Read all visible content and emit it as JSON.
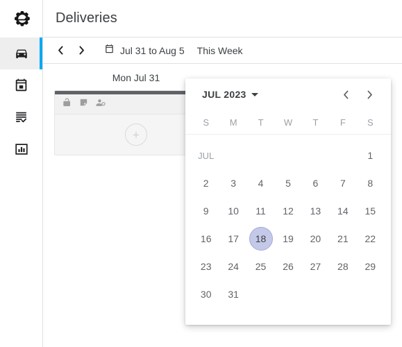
{
  "sidebar": {
    "logo_name": "gear-logo",
    "items": [
      {
        "name": "deliveries",
        "icon": "car-icon",
        "active": true
      },
      {
        "name": "calendar",
        "icon": "calendar-icon",
        "active": false
      },
      {
        "name": "tasks",
        "icon": "list-check-icon",
        "active": false
      },
      {
        "name": "reports",
        "icon": "bar-chart-icon",
        "active": false
      }
    ],
    "accent_color": "#03a9f4",
    "active_bg": "#eeeeee"
  },
  "header": {
    "title": "Deliveries"
  },
  "toolbar": {
    "prev_label": "‹",
    "next_label": "›",
    "calendar_icon": "calendar-icon",
    "date_range": "Jul 31 to Aug 5",
    "this_week": "This Week"
  },
  "board": {
    "columns": [
      {
        "header": "Mon Jul 31",
        "card": {
          "top_bar_color": "#5f6368",
          "icons": [
            "unlock-icon",
            "note-icon",
            "person-clock-icon"
          ],
          "add_label": "+"
        }
      }
    ]
  },
  "datepicker": {
    "month_year": "JUL 2023",
    "caret_icon": "chevron-down-icon",
    "prev_icon": "chevron-left-icon",
    "next_icon": "chevron-right-icon",
    "weekdays": [
      "S",
      "M",
      "T",
      "W",
      "T",
      "F",
      "S"
    ],
    "month_short": "JUL",
    "selected_day": 18,
    "selected_fill": "#c5c9e8",
    "selected_border": "#a2a9dc",
    "weeks": [
      [
        "JUL",
        "",
        "",
        "",
        "",
        "",
        "1"
      ],
      [
        "2",
        "3",
        "4",
        "5",
        "6",
        "7",
        "8"
      ],
      [
        "9",
        "10",
        "11",
        "12",
        "13",
        "14",
        "15"
      ],
      [
        "16",
        "17",
        "18",
        "19",
        "20",
        "21",
        "22"
      ],
      [
        "23",
        "24",
        "25",
        "26",
        "27",
        "28",
        "29"
      ],
      [
        "30",
        "31",
        "",
        "",
        "",
        "",
        ""
      ]
    ]
  }
}
